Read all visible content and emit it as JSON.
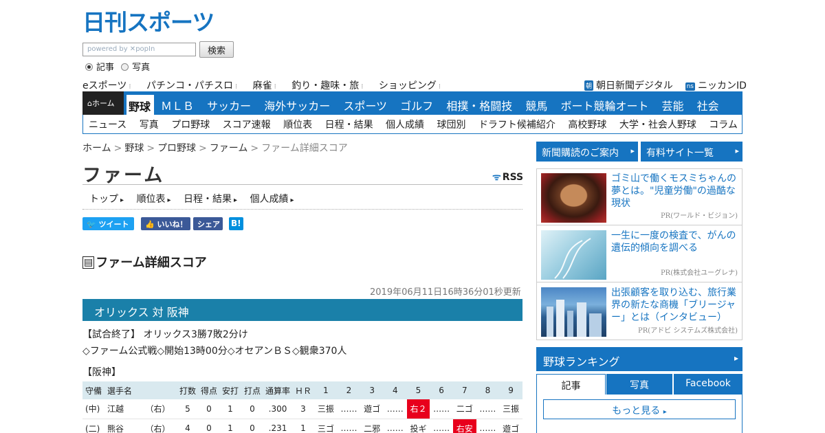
{
  "header": {
    "logo_text": "日刊スポーツ",
    "search_placeholder": "powered by ✕popIn",
    "search_button": "検索",
    "radio_article": "記事",
    "radio_photo": "写真",
    "topnav": [
      "eスポーツ",
      "パチンコ・パチスロ",
      "麻雀",
      "釣り・趣味・旅",
      "ショッピング"
    ],
    "asahi_badge": "朝",
    "asahi_label": "朝日新聞デジタル",
    "ns_badge": "ns",
    "nikkan_id": "ニッカンID"
  },
  "mainnav": {
    "home": "ホーム",
    "active": "野球",
    "items": [
      "ＭＬＢ",
      "サッカー",
      "海外サッカー",
      "スポーツ",
      "ゴルフ",
      "相撲・格闘技",
      "競馬",
      "ボート競輪オート",
      "芸能",
      "社会"
    ]
  },
  "subnav": [
    "ニュース",
    "写真",
    "プロ野球",
    "スコア速報",
    "順位表",
    "日程・結果",
    "個人成績",
    "球団別",
    "ドラフト候補紹介",
    "高校野球",
    "大学・社会人野球",
    "コラム"
  ],
  "breadcrumb": {
    "items": [
      "ホーム",
      "野球",
      "プロ野球",
      "ファーム"
    ],
    "sep": ">",
    "current": "ファーム詳細スコア"
  },
  "page": {
    "title": "ファーム",
    "rss": "RSS",
    "subtabs": [
      "トップ",
      "順位表",
      "日程・結果",
      "個人成績"
    ],
    "share": {
      "tweet": "ツイート",
      "like": "いいね！",
      "share": "シェア",
      "hatena": "B!"
    },
    "section_title": "ファーム詳細スコア",
    "updated": "2019年06月11日16時36分01秒更新",
    "match": "オリックス 対 阪神",
    "result": "【試合終了】 オリックス3勝7敗2分け",
    "game_info": "◇ファーム公式戦◇開始13時00分◇オセアンＢＳ◇観衆370人",
    "team": "【阪神】"
  },
  "box_score": {
    "headers": [
      "守備",
      "選手名",
      "",
      "打数",
      "得点",
      "安打",
      "打点",
      "通算率",
      "ＨＲ",
      "1",
      "2",
      "3",
      "4",
      "5",
      "6",
      "7",
      "8",
      "9"
    ],
    "rows": [
      {
        "pos": "(中)",
        "name": "江越",
        "hand": "（右）",
        "ab": "5",
        "r": "0",
        "h": "1",
        "rbi": "0",
        "avg": ".300",
        "hr": "3",
        "innings": [
          "三振",
          "……",
          "遊ゴ",
          "……",
          "右２",
          "……",
          "二ゴ",
          "……",
          "三振"
        ]
      },
      {
        "pos": "(二)",
        "name": "熊谷",
        "hand": "（右）",
        "ab": "4",
        "r": "0",
        "h": "1",
        "rbi": "0",
        "avg": ".231",
        "hr": "1",
        "innings": [
          "三ゴ",
          "……",
          "二邪",
          "……",
          "投ギ",
          "……",
          "右安",
          "……",
          "遊ゴ"
        ]
      }
    ],
    "hit_color": "#e8001c"
  },
  "sidebar": {
    "subscribe": "新聞購読のご案内",
    "paid_sites": "有料サイト一覧",
    "ads": [
      {
        "title": "ゴミ山で働くモスミちゃんの夢とは。\"児童労働\"の過酷な現状",
        "pr": "PR(ワールド・ビジョン)"
      },
      {
        "title": "一生に一度の検査で、がんの遺伝的傾向を調べる",
        "pr": "PR(株式会社ユーグレナ)"
      },
      {
        "title": "出張顧客を取り込む、旅行業界の新たな商機「ブリージャー」とは（インタビュー）",
        "pr": "PR(アドビ システムズ株式会社)"
      }
    ],
    "ranking_title": "野球ランキング",
    "ranking_tabs": [
      "記事",
      "写真",
      "Facebook"
    ],
    "more": "もっと見る"
  },
  "colors": {
    "brand": "#1674c1",
    "match_bar": "#1a80a9",
    "hit": "#e8001c"
  }
}
